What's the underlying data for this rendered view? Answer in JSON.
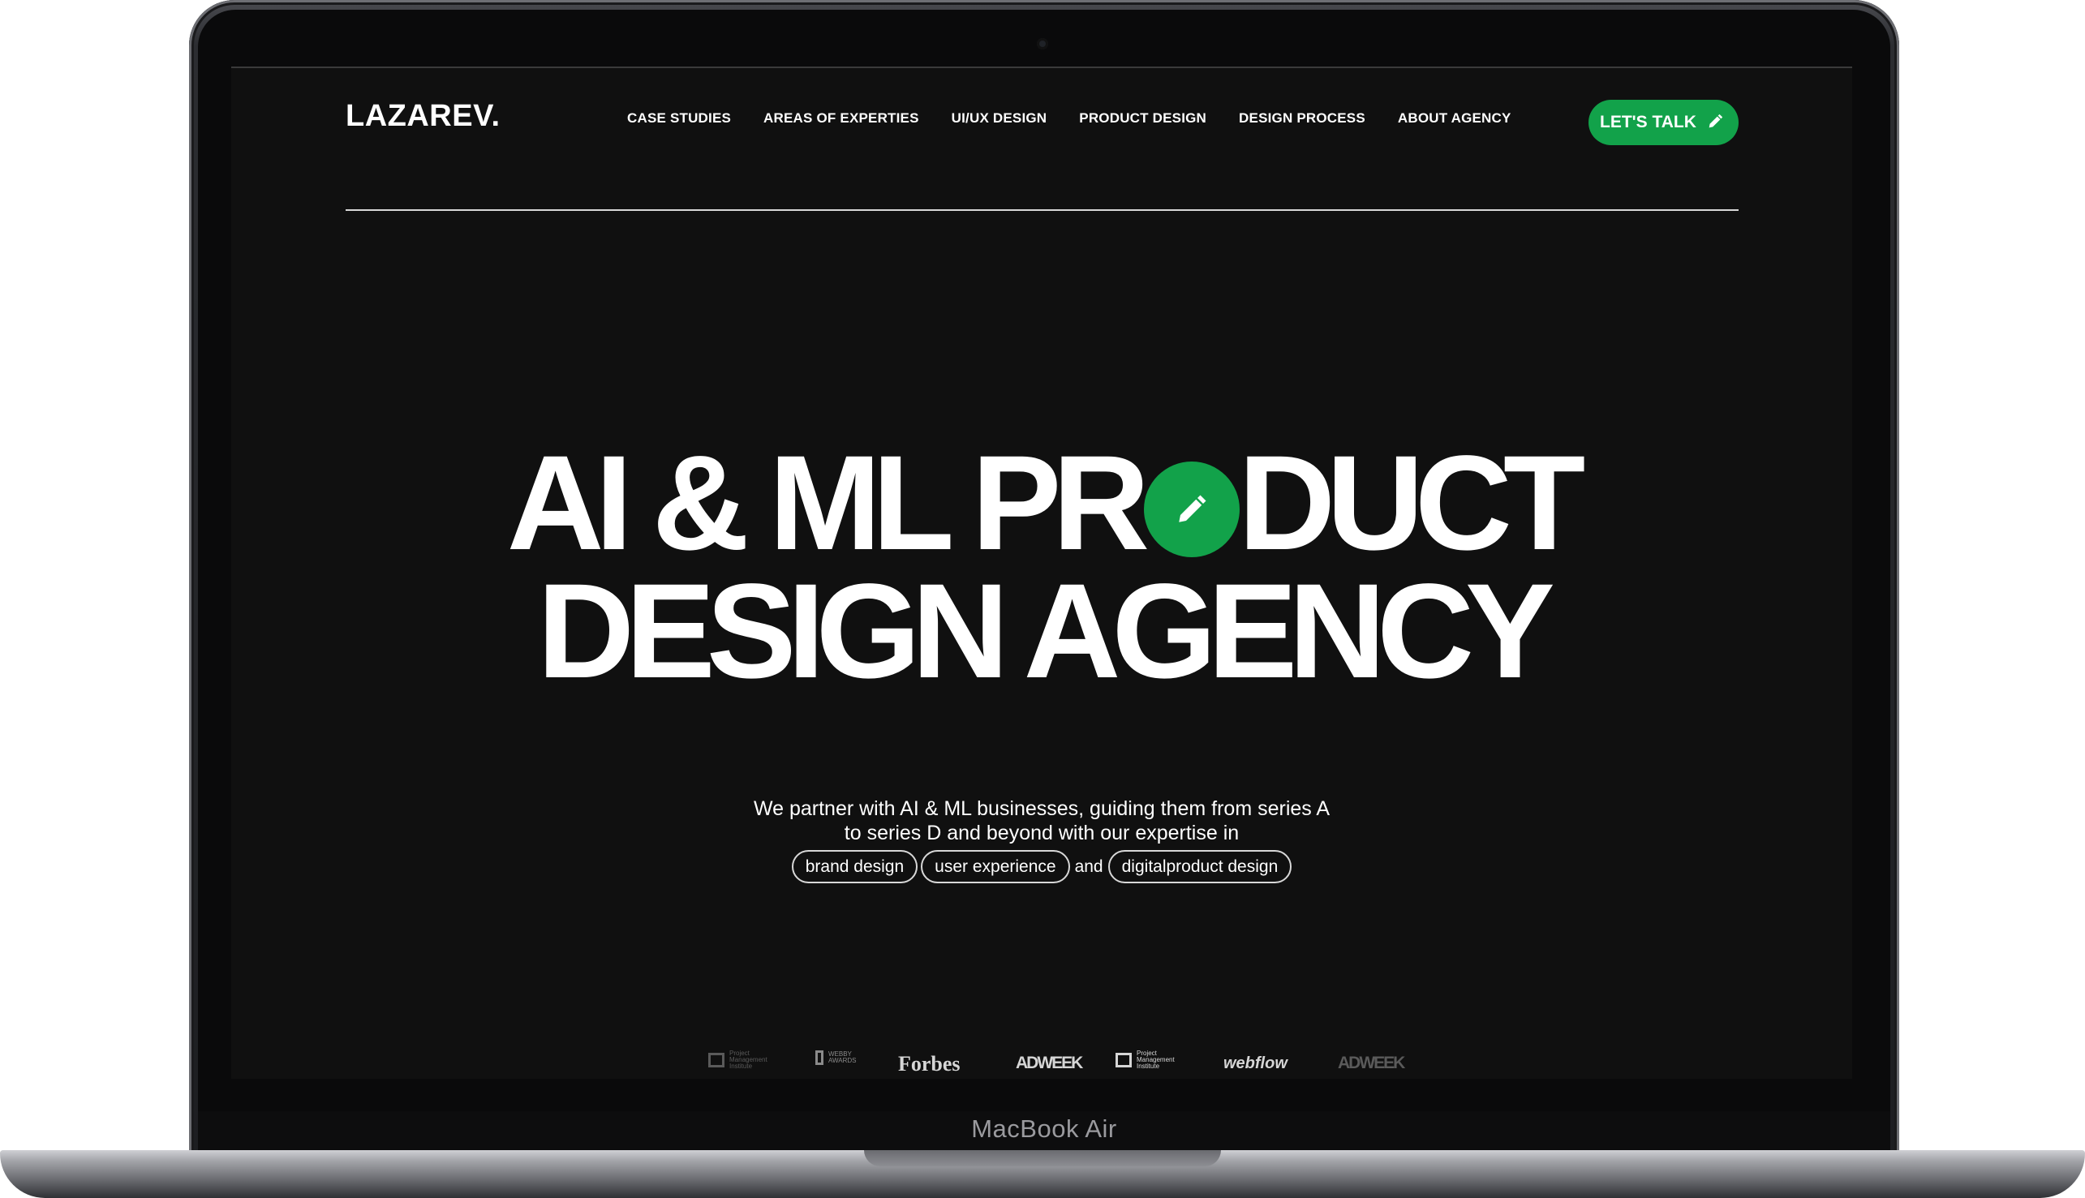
{
  "device": {
    "label": "MacBook Air"
  },
  "header": {
    "logo": "LAZAREV.",
    "nav": [
      {
        "label": "CASE STUDIES"
      },
      {
        "label": "AREAS OF EXPERTIES"
      },
      {
        "label": "UI/UX DESIGN"
      },
      {
        "label": "PRODUCT DESIGN"
      },
      {
        "label": "DESIGN PROCESS"
      },
      {
        "label": "ABOUT AGENCY"
      }
    ],
    "cta_label": "LET'S TALK"
  },
  "hero": {
    "line1_start": "AI & ML PR",
    "line1_end": "DUCT",
    "line2": "DESIGN AGENCY"
  },
  "intro": {
    "line1": "We partner with AI & ML businesses, guiding them from series A",
    "line2": "to series D and beyond with our expertise in",
    "chips": [
      "brand design",
      "user experience",
      "digitalproduct design"
    ],
    "conjunction": "and"
  },
  "partners": [
    {
      "name": "Project Management Institute",
      "text": "Project Management Institute"
    },
    {
      "name": "Webby Awards",
      "text": "WEBBY AWARDS"
    },
    {
      "name": "Forbes",
      "text": "Forbes"
    },
    {
      "name": "Adweek",
      "text": "ADWEEK"
    },
    {
      "name": "Project Management Institute",
      "text": "Project Management Institute"
    },
    {
      "name": "Webflow",
      "text": "webflow"
    },
    {
      "name": "Adweek",
      "text": "ADWEEK"
    }
  ],
  "colors": {
    "accent": "#12a24a",
    "background": "#101010",
    "text": "#ffffff"
  },
  "icons": {
    "cta": "pencil-icon",
    "hero_o": "pencil-icon"
  }
}
